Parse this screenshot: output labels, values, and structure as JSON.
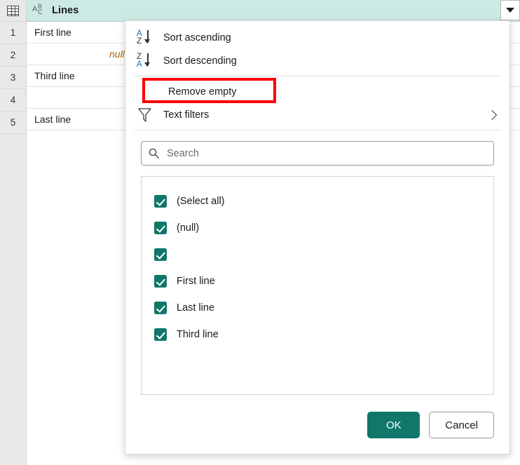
{
  "grid": {
    "table_icon_name": "table-grid-icon",
    "column": {
      "type_icon": "abc-text-type-icon",
      "type_letters": {
        "a": "A",
        "b": "B",
        "c": "C"
      },
      "name": "Lines",
      "dropdown_icon": "caret-down-icon"
    },
    "row_numbers": [
      "1",
      "2",
      "3",
      "4",
      "5"
    ],
    "rows": [
      {
        "value": "First line",
        "overlay": ""
      },
      {
        "value": "",
        "overlay": "null"
      },
      {
        "value": "Third line",
        "overlay": ""
      },
      {
        "value": "",
        "overlay": ""
      },
      {
        "value": "Last line",
        "overlay": ""
      }
    ]
  },
  "filter_panel": {
    "menu": [
      {
        "label": "Sort ascending",
        "icon": "sort-ascending-az-icon",
        "top_letter": "A",
        "bottom_letter": "Z",
        "highlighted": false
      },
      {
        "label": "Sort descending",
        "icon": "sort-descending-za-icon",
        "top_letter": "Z",
        "bottom_letter": "A",
        "highlighted": false
      },
      {
        "label": "Remove empty",
        "icon": "none",
        "highlighted": true
      },
      {
        "label": "Text filters",
        "icon": "funnel-filter-icon",
        "submenu_icon": "chevron-right-icon",
        "highlighted": false
      }
    ],
    "highlight_color": "#ff0000",
    "search": {
      "icon": "search-magnifier-icon",
      "placeholder": "Search",
      "value": ""
    },
    "checkbox_list": [
      {
        "label": "(Select all)",
        "checked": true
      },
      {
        "label": "(null)",
        "checked": true
      },
      {
        "label": "",
        "checked": true
      },
      {
        "label": "First line",
        "checked": true
      },
      {
        "label": "Last line",
        "checked": true
      },
      {
        "label": "Third line",
        "checked": true
      }
    ],
    "buttons": {
      "ok": "OK",
      "cancel": "Cancel"
    },
    "accent_color": "#10776a",
    "header_color": "#cde9e4"
  }
}
